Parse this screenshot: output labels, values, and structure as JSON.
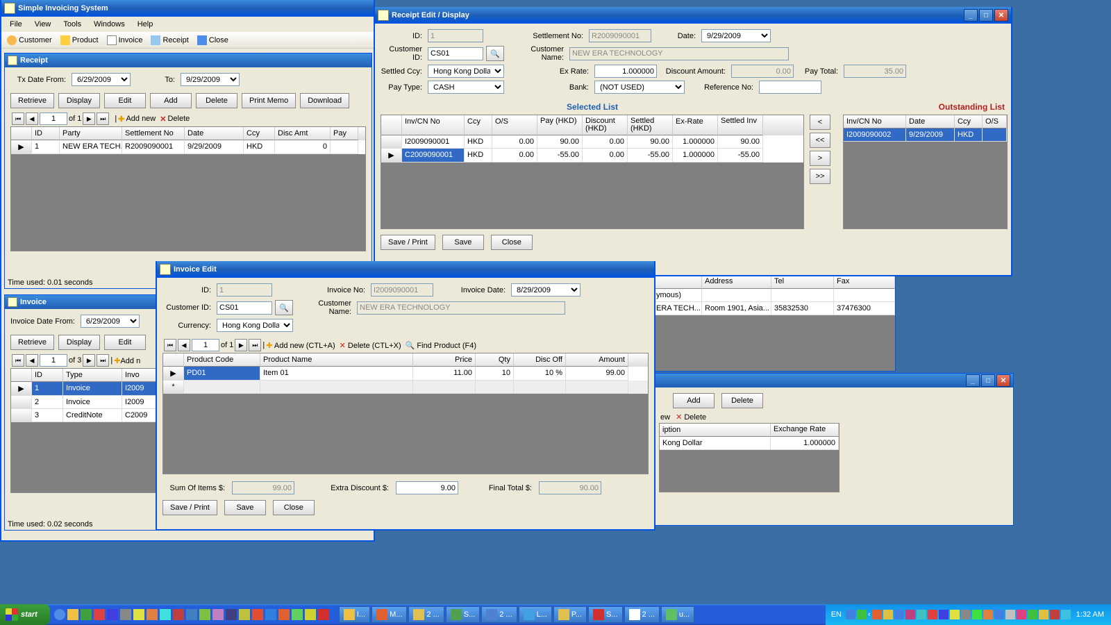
{
  "mainApp": {
    "title": "Simple Invoicing System",
    "menus": [
      "File",
      "View",
      "Tools",
      "Windows",
      "Help"
    ],
    "toolbar": [
      {
        "icon": "customer",
        "label": "Customer"
      },
      {
        "icon": "product",
        "label": "Product"
      },
      {
        "icon": "invoice",
        "label": "Invoice"
      },
      {
        "icon": "receipt",
        "label": "Receipt"
      },
      {
        "icon": "close",
        "label": "Close"
      }
    ]
  },
  "receiptWin": {
    "title": "Receipt",
    "txDateFromLabel": "Tx Date From:",
    "txDateFrom": "6/29/2009",
    "toLabel": "To:",
    "txDateTo": "9/29/2009",
    "buttons": [
      "Retrieve",
      "Display",
      "Edit",
      "Add",
      "Delete",
      "Print Memo",
      "Download"
    ],
    "navPos": "1",
    "navOf": "of 1",
    "addNew": "Add new",
    "delete": "Delete",
    "cols": [
      "ID",
      "Party",
      "Settlement No",
      "Date",
      "Ccy",
      "Disc Amt",
      "Pay"
    ],
    "rows": [
      [
        "1",
        "NEW ERA TECH...",
        "R2009090001",
        "9/29/2009",
        "HKD",
        "0",
        ""
      ]
    ],
    "status": "Time used: 0.01 seconds"
  },
  "invoiceWin": {
    "title": "Invoice",
    "dateFromLabel": "Invoice Date From:",
    "dateFrom": "6/29/2009",
    "buttons": [
      "Retrieve",
      "Display",
      "Edit"
    ],
    "navPos": "1",
    "navOf": "of 3",
    "addN": "Add n",
    "cols": [
      "ID",
      "Type",
      "Invo"
    ],
    "rows": [
      [
        "1",
        "Invoice",
        "I2009"
      ],
      [
        "2",
        "Invoice",
        "I2009"
      ],
      [
        "3",
        "CreditNote",
        "C2009"
      ]
    ],
    "status": "Time used: 0.02 seconds"
  },
  "receiptEdit": {
    "title": "Receipt Edit / Display",
    "idLabel": "ID:",
    "id": "1",
    "settNoLabel": "Settlement No:",
    "settNo": "R2009090001",
    "dateLabel": "Date:",
    "date": "9/29/2009",
    "custIdLabel": "Customer ID:",
    "custId": "CS01",
    "custNameLabel": "Customer Name:",
    "custName": "NEW ERA TECHNOLOGY",
    "ccyLabel": "Settled Ccy:",
    "ccy": "Hong Kong Dollar",
    "exRateLabel": "Ex Rate:",
    "exRate": "1.000000",
    "discAmtLabel": "Discount Amount:",
    "discAmt": "0.00",
    "payTotalLabel": "Pay Total:",
    "payTotal": "35.00",
    "payTypeLabel": "Pay Type:",
    "payType": "CASH",
    "bankLabel": "Bank:",
    "bank": "(NOT USED)",
    "refNoLabel": "Reference No:",
    "refNo": "",
    "selectedListTitle": "Selected List",
    "outstandingListTitle": "Outstanding List",
    "selCols": [
      "Inv/CN No",
      "Ccy",
      "O/S",
      "Pay (HKD)",
      "Discount (HKD)",
      "Settled (HKD)",
      "Ex-Rate",
      "Settled Inv"
    ],
    "selRows": [
      [
        "I2009090001",
        "HKD",
        "0.00",
        "90.00",
        "0.00",
        "90.00",
        "1.000000",
        "90.00"
      ],
      [
        "C2009090001",
        "HKD",
        "0.00",
        "-55.00",
        "0.00",
        "-55.00",
        "1.000000",
        "-55.00"
      ]
    ],
    "outCols": [
      "Inv/CN No",
      "Date",
      "Ccy",
      "O/S"
    ],
    "outRows": [
      [
        "I2009090002",
        "9/29/2009",
        "HKD",
        ""
      ]
    ],
    "footerBtns": [
      "Save / Print",
      "Save",
      "Close"
    ]
  },
  "invoiceEdit": {
    "title": "Invoice Edit",
    "idLabel": "ID:",
    "id": "1",
    "invNoLabel": "Invoice No:",
    "invNo": "I2009090001",
    "invDateLabel": "Invoice Date:",
    "invDate": "8/29/2009",
    "custIdLabel": "Customer ID:",
    "custId": "CS01",
    "custNameLabel": "Customer Name:",
    "custName": "NEW ERA TECHNOLOGY",
    "ccyLabel": "Currency:",
    "ccy": "Hong Kong Dollar",
    "navPos": "1",
    "navOf": "of 1",
    "addNew": "Add new (CTL+A)",
    "delete": "Delete (CTL+X)",
    "findProd": "Find Product (F4)",
    "cols": [
      "Product Code",
      "Product Name",
      "Price",
      "Qty",
      "Disc Off",
      "Amount"
    ],
    "rows": [
      [
        "PD01",
        "Item 01",
        "11.00",
        "10",
        "10 %",
        "99.00"
      ]
    ],
    "sumLabel": "Sum Of Items $:",
    "sum": "99.00",
    "extraDiscLabel": "Extra Discount $:",
    "extraDisc": "9.00",
    "finalLabel": "Final Total $:",
    "final": "90.00",
    "footerBtns": [
      "Save / Print",
      "Save",
      "Close"
    ]
  },
  "partialCustomer": {
    "colAddress": "Address",
    "colTel": "Tel",
    "colFax": "Fax",
    "row1": "ymous)",
    "row2": [
      "ERA TECH...",
      "Room 1901, Asia...",
      "35832530",
      "37476300"
    ]
  },
  "partialCurrency": {
    "addBtn": "Add",
    "deleteBtn": "Delete",
    "ew": "ew",
    "delete": "Delete",
    "colDesc": "iption",
    "colRate": "Exchange Rate",
    "row": [
      "Kong Dollar",
      "1.000000"
    ]
  },
  "taskbar": {
    "start": "start",
    "tasks": [
      "I...",
      "M...",
      "2 ...",
      "S...",
      "2 ...",
      "L...",
      "P...",
      "S...",
      "2 ...",
      "u..."
    ],
    "lang": "EN",
    "clock": "1:32 AM"
  }
}
